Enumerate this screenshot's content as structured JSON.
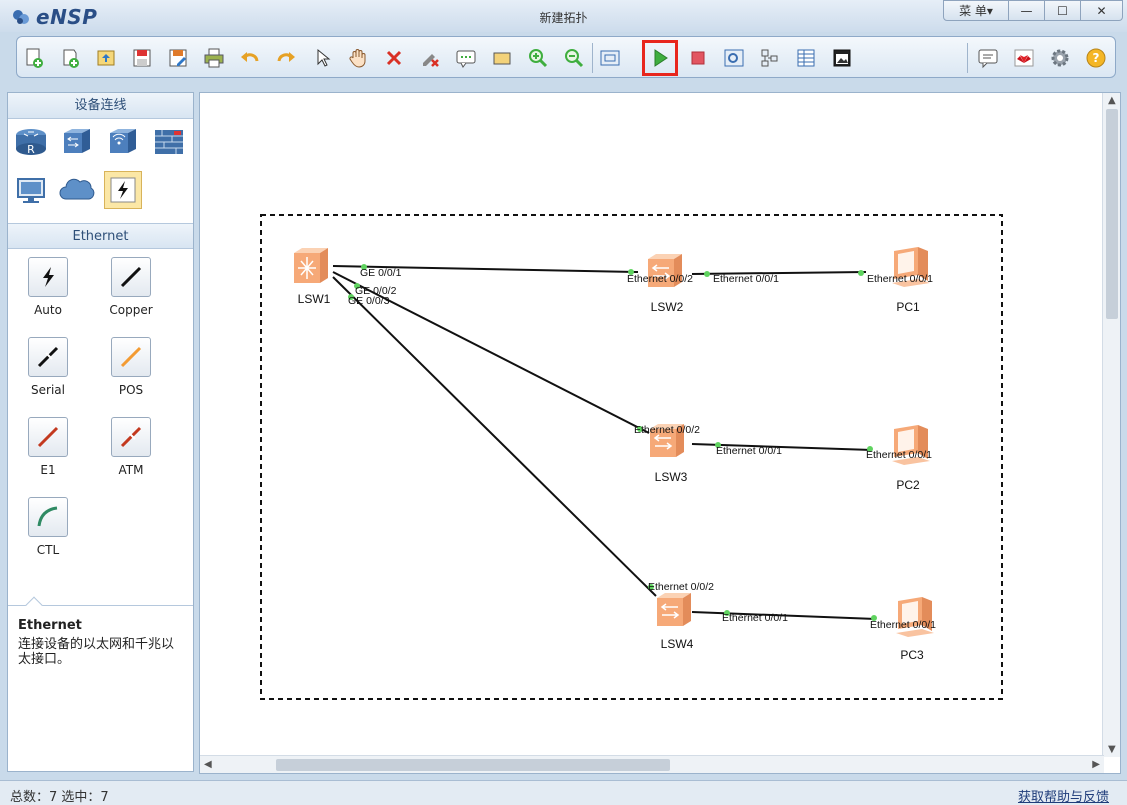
{
  "app": {
    "name": "eNSP",
    "window_title": "新建拓扑"
  },
  "window_controls": {
    "menu_label": "菜 单▾",
    "minimize": "—",
    "maximize": "☐",
    "close": "✕"
  },
  "toolbar": {
    "items": [
      "new-topology-icon",
      "new-lab-icon",
      "open-icon",
      "save-icon",
      "save-as-icon",
      "print-icon",
      "undo-icon",
      "redo-icon",
      "select-cursor-icon",
      "pan-hand-icon",
      "delete-icon",
      "delete-connection-icon",
      "text-note-icon",
      "rectangle-icon",
      "zoom-in-icon",
      "zoom-out-icon",
      "fit-view-icon",
      "start-device-icon",
      "stop-device-icon",
      "capture-icon",
      "topology-tree-icon",
      "grid-icon",
      "screenshot-icon",
      "forum-icon",
      "huawei-icon",
      "settings-icon",
      "help-icon"
    ],
    "highlighted": "start-device-icon",
    "highlight_color": "#e8261d"
  },
  "left_panel": {
    "devices_header": "设备连线",
    "devices": [
      "router-icon",
      "switch-icon",
      "wireless-icon",
      "firewall-icon",
      "pc-icon",
      "cloud-icon",
      "connection-icon"
    ],
    "selected_device": "connection-icon",
    "cables_header": "Ethernet",
    "cables": [
      {
        "label": "Auto",
        "color": "#111111"
      },
      {
        "label": "Copper",
        "color": "#111111"
      },
      {
        "label": "Serial",
        "color": "#111111"
      },
      {
        "label": "POS",
        "color": "#f39b33"
      },
      {
        "label": "E1",
        "color": "#c3391f"
      },
      {
        "label": "ATM",
        "color": "#c3391f"
      },
      {
        "label": "CTL",
        "color": "#2f8a63"
      }
    ],
    "description": {
      "title": "Ethernet",
      "text": "连接设备的以太网和千兆以太接口。"
    }
  },
  "topology": {
    "devices": [
      {
        "name": "LSW1",
        "type": "core-switch"
      },
      {
        "name": "LSW2",
        "type": "switch"
      },
      {
        "name": "LSW3",
        "type": "switch"
      },
      {
        "name": "LSW4",
        "type": "switch"
      },
      {
        "name": "PC1",
        "type": "pc"
      },
      {
        "name": "PC2",
        "type": "pc"
      },
      {
        "name": "PC3",
        "type": "pc"
      }
    ],
    "links": [
      {
        "from": "LSW1",
        "from_port": "GE 0/0/1",
        "to": "LSW2",
        "to_port": "Ethernet 0/0/2"
      },
      {
        "from": "LSW1",
        "from_port": "GE 0/0/2",
        "to": "LSW3",
        "to_port": "Ethernet 0/0/2"
      },
      {
        "from": "LSW1",
        "from_port": "GE 0/0/3",
        "to": "LSW4",
        "to_port": "Ethernet 0/0/2"
      },
      {
        "from": "LSW2",
        "from_port": "Ethernet 0/0/1",
        "to": "PC1",
        "to_port": "Ethernet 0/0/1"
      },
      {
        "from": "LSW3",
        "from_port": "Ethernet 0/0/1",
        "to": "PC2",
        "to_port": "Ethernet 0/0/1"
      },
      {
        "from": "LSW4",
        "from_port": "Ethernet 0/0/1",
        "to": "PC3",
        "to_port": "Ethernet 0/0/1"
      }
    ]
  },
  "status": {
    "counts": "总数：7  选中：7",
    "help_link": "获取帮助与反馈"
  }
}
